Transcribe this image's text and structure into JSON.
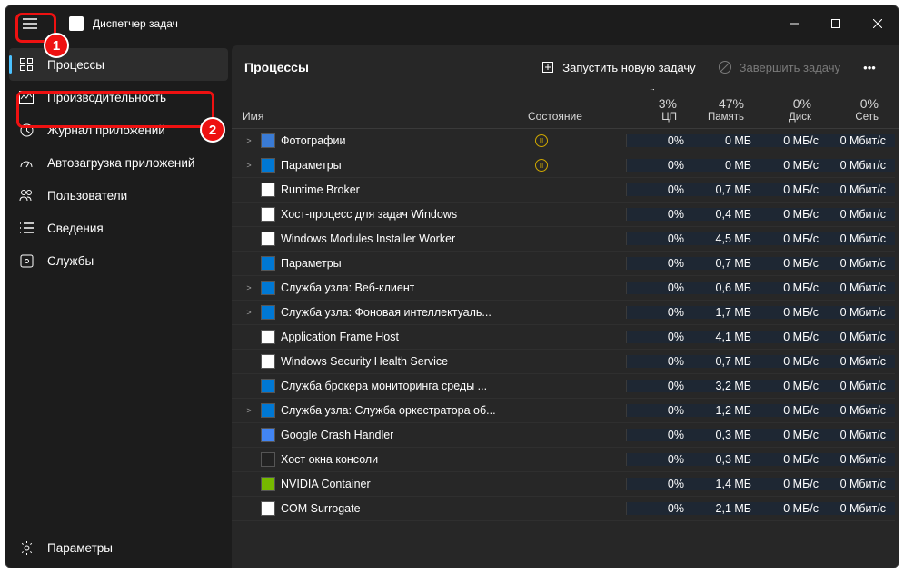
{
  "window": {
    "title": "Диспетчер задач"
  },
  "sidebar": {
    "items": [
      {
        "label": "Процессы",
        "icon": "grid"
      },
      {
        "label": "Производительность",
        "icon": "wave"
      },
      {
        "label": "Журнал приложений",
        "icon": "clock"
      },
      {
        "label": "Автозагрузка приложений",
        "icon": "gauge"
      },
      {
        "label": "Пользователи",
        "icon": "users"
      },
      {
        "label": "Сведения",
        "icon": "list"
      },
      {
        "label": "Службы",
        "icon": "service"
      }
    ],
    "settings": "Параметры"
  },
  "content": {
    "title": "Процессы",
    "run_new": "Запустить новую задачу",
    "end_task": "Завершить задачу"
  },
  "columns": {
    "name": "Имя",
    "status": "Состояние",
    "cpu_pct": "3%",
    "cpu_label": "ЦП",
    "mem_pct": "47%",
    "mem_label": "Память",
    "disk_pct": "0%",
    "disk_label": "Диск",
    "net_pct": "0%",
    "net_label": "Сеть"
  },
  "rows": [
    {
      "expand": true,
      "icon": "#3a7bd5",
      "name": "Фотографии",
      "paused": true,
      "cpu": "0%",
      "mem": "0 МБ",
      "disk": "0 МБ/с",
      "net": "0 Мбит/с"
    },
    {
      "expand": true,
      "icon": "#0078d4",
      "name": "Параметры",
      "paused": true,
      "cpu": "0%",
      "mem": "0 МБ",
      "disk": "0 МБ/с",
      "net": "0 Мбит/с"
    },
    {
      "expand": false,
      "icon": "#fff",
      "name": "Runtime Broker",
      "cpu": "0%",
      "mem": "0,7 МБ",
      "disk": "0 МБ/с",
      "net": "0 Мбит/с"
    },
    {
      "expand": false,
      "icon": "#fff",
      "name": "Хост-процесс для задач Windows",
      "cpu": "0%",
      "mem": "0,4 МБ",
      "disk": "0 МБ/с",
      "net": "0 Мбит/с"
    },
    {
      "expand": false,
      "icon": "#fff",
      "name": "Windows Modules Installer Worker",
      "cpu": "0%",
      "mem": "4,5 МБ",
      "disk": "0 МБ/с",
      "net": "0 Мбит/с"
    },
    {
      "expand": false,
      "icon": "#0078d4",
      "name": "Параметры",
      "cpu": "0%",
      "mem": "0,7 МБ",
      "disk": "0 МБ/с",
      "net": "0 Мбит/с"
    },
    {
      "expand": true,
      "icon": "#0078d4",
      "name": "Служба узла: Веб-клиент",
      "cpu": "0%",
      "mem": "0,6 МБ",
      "disk": "0 МБ/с",
      "net": "0 Мбит/с"
    },
    {
      "expand": true,
      "icon": "#0078d4",
      "name": "Служба узла: Фоновая интеллектуаль...",
      "cpu": "0%",
      "mem": "1,7 МБ",
      "disk": "0 МБ/с",
      "net": "0 Мбит/с"
    },
    {
      "expand": false,
      "icon": "#fff",
      "name": "Application Frame Host",
      "cpu": "0%",
      "mem": "4,1 МБ",
      "disk": "0 МБ/с",
      "net": "0 Мбит/с"
    },
    {
      "expand": false,
      "icon": "#fff",
      "name": "Windows Security Health Service",
      "cpu": "0%",
      "mem": "0,7 МБ",
      "disk": "0 МБ/с",
      "net": "0 Мбит/с"
    },
    {
      "expand": false,
      "icon": "#0078d4",
      "name": "Служба брокера мониторинга среды ...",
      "cpu": "0%",
      "mem": "3,2 МБ",
      "disk": "0 МБ/с",
      "net": "0 Мбит/с"
    },
    {
      "expand": true,
      "icon": "#0078d4",
      "name": "Служба узла: Служба оркестратора об...",
      "cpu": "0%",
      "mem": "1,2 МБ",
      "disk": "0 МБ/с",
      "net": "0 Мбит/с"
    },
    {
      "expand": false,
      "icon": "#4285f4",
      "name": "Google Crash Handler",
      "cpu": "0%",
      "mem": "0,3 МБ",
      "disk": "0 МБ/с",
      "net": "0 Мбит/с"
    },
    {
      "expand": false,
      "icon": "#222",
      "name": "Хост окна консоли",
      "cpu": "0%",
      "mem": "0,3 МБ",
      "disk": "0 МБ/с",
      "net": "0 Мбит/с"
    },
    {
      "expand": false,
      "icon": "#76b900",
      "name": "NVIDIA Container",
      "cpu": "0%",
      "mem": "1,4 МБ",
      "disk": "0 МБ/с",
      "net": "0 Мбит/с"
    },
    {
      "expand": false,
      "icon": "#fff",
      "name": "COM Surrogate",
      "cpu": "0%",
      "mem": "2,1 МБ",
      "disk": "0 МБ/с",
      "net": "0 Мбит/с"
    }
  ],
  "markers": {
    "1": "1",
    "2": "2"
  }
}
